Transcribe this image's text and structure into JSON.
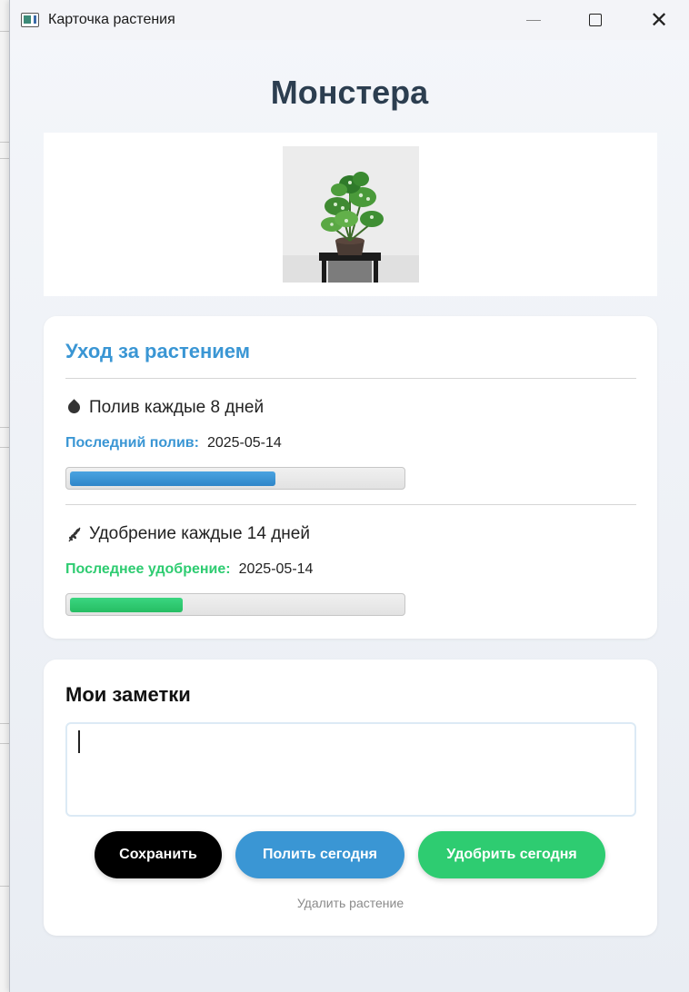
{
  "window": {
    "title": "Карточка растения"
  },
  "plant": {
    "name": "Монстера",
    "photo_icon": "monstera-plant-photo"
  },
  "care": {
    "title": "Уход за растением",
    "watering": {
      "icon": "water-drop-icon",
      "frequency_text": "Полив каждые 8 дней",
      "last_label": "Последний полив:",
      "last_date": "2025-05-14",
      "progress": 0.62,
      "color": "#3a96d4"
    },
    "fertilizing": {
      "icon": "herb-icon",
      "frequency_text": "Удобрение каждые 14 дней",
      "last_label": "Последнее удобрение:",
      "last_date": "2025-05-14",
      "progress": 0.34,
      "color": "#2ecc71"
    }
  },
  "notes": {
    "title": "Мои заметки",
    "value": "",
    "buttons": {
      "save": "Сохранить",
      "water_today": "Полить сегодня",
      "fertilize_today": "Удобрить сегодня"
    },
    "delete_link": "Удалить растение"
  }
}
